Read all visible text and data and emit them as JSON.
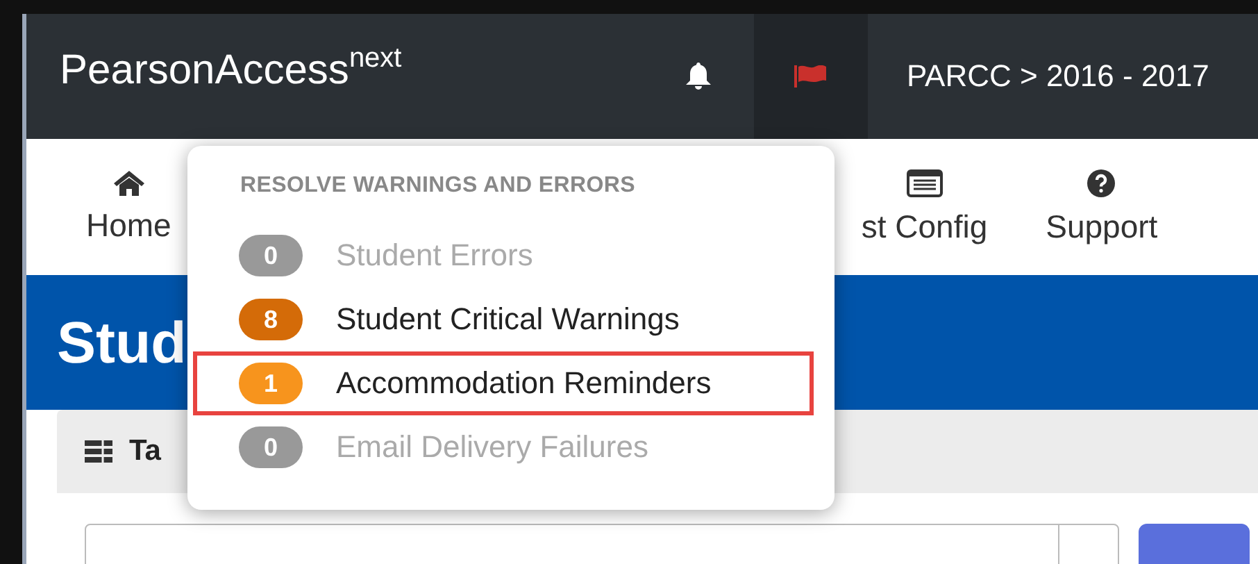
{
  "header": {
    "brand": "PearsonAccess",
    "brand_sup": "next",
    "breadcrumb": "PARCC > 2016 - 2017"
  },
  "nav": [
    {
      "label": "Home"
    },
    {
      "label": "st Config"
    },
    {
      "label": "Support"
    }
  ],
  "page_title": "Stud",
  "tasks_panel": {
    "title": "Ta"
  },
  "dropdown": {
    "heading": "RESOLVE WARNINGS AND ERRORS",
    "items": [
      {
        "count": "0",
        "label": "Student Errors",
        "color": "#999999",
        "disabled": true,
        "selected": false
      },
      {
        "count": "8",
        "label": "Student Critical Warnings",
        "color": "#d46b08",
        "disabled": false,
        "selected": false
      },
      {
        "count": "1",
        "label": "Accommodation Reminders",
        "color": "#f7941d",
        "disabled": false,
        "selected": true
      },
      {
        "count": "0",
        "label": "Email Delivery Failures",
        "color": "#999999",
        "disabled": true,
        "selected": false
      }
    ]
  }
}
